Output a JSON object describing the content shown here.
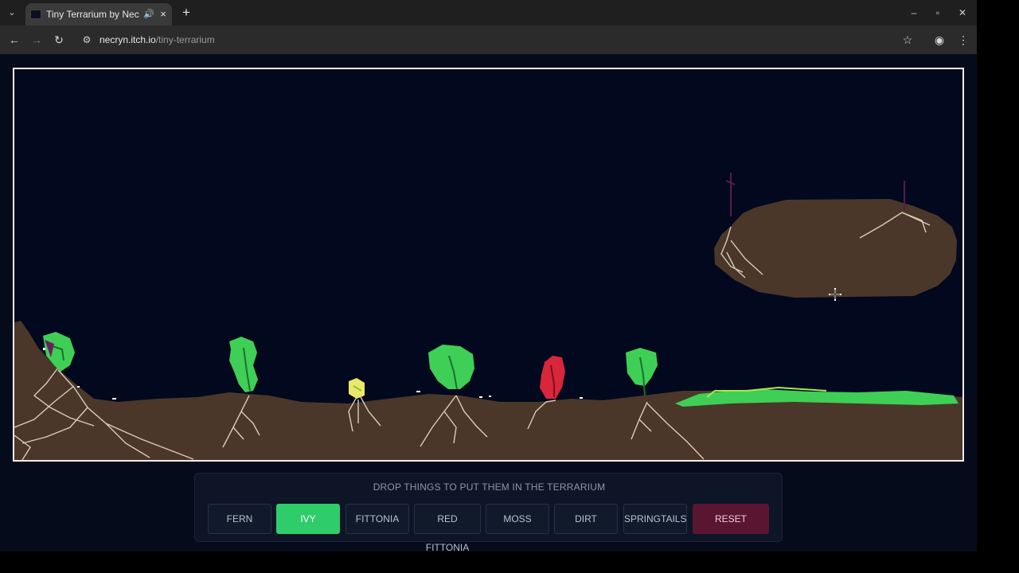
{
  "browser": {
    "tab_title": "Tiny Terrarium by Nec",
    "tab_audio_icon": "speaker-icon",
    "tab_close": "×",
    "new_tab": "+",
    "tab_list": "⌄",
    "minimize": "–",
    "maximize": "▫",
    "close": "✕",
    "back": "←",
    "forward": "→",
    "reload": "↻",
    "site_info": "⚙",
    "url_host": "necryn.itch.io",
    "url_path": "/tiny-terrarium",
    "bookmark": "☆",
    "profile": "◉",
    "menu": "⋮"
  },
  "game": {
    "hint": "DROP THINGS TO PUT THEM IN THE TERRARIUM",
    "buttons": [
      {
        "label": "FERN",
        "active": false
      },
      {
        "label": "IVY",
        "active": true
      },
      {
        "label": "FITTONIA",
        "active": false
      },
      {
        "label": "RED FITTONIA",
        "active": false
      },
      {
        "label": "MOSS",
        "active": false
      },
      {
        "label": "DIRT",
        "active": false
      },
      {
        "label": "SPRINGTAILS",
        "active": false
      },
      {
        "label": "RESET",
        "active": false
      }
    ],
    "colors": {
      "background": "#02091e",
      "dirt": "#4a3729",
      "root": "#d9cdb6",
      "plant_green": "#3fcf56",
      "plant_red": "#d8263a",
      "active_button": "#2fcc6a",
      "reset_button": "#5a1630"
    }
  }
}
